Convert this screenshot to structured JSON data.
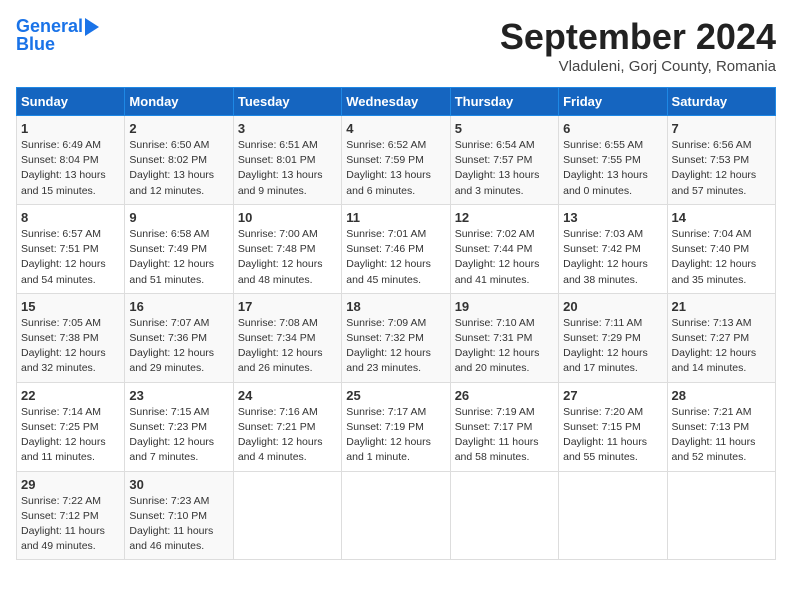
{
  "logo": {
    "line1": "General",
    "line2": "Blue"
  },
  "title": "September 2024",
  "subtitle": "Vladuleni, Gorj County, Romania",
  "headers": [
    "Sunday",
    "Monday",
    "Tuesday",
    "Wednesday",
    "Thursday",
    "Friday",
    "Saturday"
  ],
  "weeks": [
    [
      {
        "day": "1",
        "info": "Sunrise: 6:49 AM\nSunset: 8:04 PM\nDaylight: 13 hours\nand 15 minutes."
      },
      {
        "day": "2",
        "info": "Sunrise: 6:50 AM\nSunset: 8:02 PM\nDaylight: 13 hours\nand 12 minutes."
      },
      {
        "day": "3",
        "info": "Sunrise: 6:51 AM\nSunset: 8:01 PM\nDaylight: 13 hours\nand 9 minutes."
      },
      {
        "day": "4",
        "info": "Sunrise: 6:52 AM\nSunset: 7:59 PM\nDaylight: 13 hours\nand 6 minutes."
      },
      {
        "day": "5",
        "info": "Sunrise: 6:54 AM\nSunset: 7:57 PM\nDaylight: 13 hours\nand 3 minutes."
      },
      {
        "day": "6",
        "info": "Sunrise: 6:55 AM\nSunset: 7:55 PM\nDaylight: 13 hours\nand 0 minutes."
      },
      {
        "day": "7",
        "info": "Sunrise: 6:56 AM\nSunset: 7:53 PM\nDaylight: 12 hours\nand 57 minutes."
      }
    ],
    [
      {
        "day": "8",
        "info": "Sunrise: 6:57 AM\nSunset: 7:51 PM\nDaylight: 12 hours\nand 54 minutes."
      },
      {
        "day": "9",
        "info": "Sunrise: 6:58 AM\nSunset: 7:49 PM\nDaylight: 12 hours\nand 51 minutes."
      },
      {
        "day": "10",
        "info": "Sunrise: 7:00 AM\nSunset: 7:48 PM\nDaylight: 12 hours\nand 48 minutes."
      },
      {
        "day": "11",
        "info": "Sunrise: 7:01 AM\nSunset: 7:46 PM\nDaylight: 12 hours\nand 45 minutes."
      },
      {
        "day": "12",
        "info": "Sunrise: 7:02 AM\nSunset: 7:44 PM\nDaylight: 12 hours\nand 41 minutes."
      },
      {
        "day": "13",
        "info": "Sunrise: 7:03 AM\nSunset: 7:42 PM\nDaylight: 12 hours\nand 38 minutes."
      },
      {
        "day": "14",
        "info": "Sunrise: 7:04 AM\nSunset: 7:40 PM\nDaylight: 12 hours\nand 35 minutes."
      }
    ],
    [
      {
        "day": "15",
        "info": "Sunrise: 7:05 AM\nSunset: 7:38 PM\nDaylight: 12 hours\nand 32 minutes."
      },
      {
        "day": "16",
        "info": "Sunrise: 7:07 AM\nSunset: 7:36 PM\nDaylight: 12 hours\nand 29 minutes."
      },
      {
        "day": "17",
        "info": "Sunrise: 7:08 AM\nSunset: 7:34 PM\nDaylight: 12 hours\nand 26 minutes."
      },
      {
        "day": "18",
        "info": "Sunrise: 7:09 AM\nSunset: 7:32 PM\nDaylight: 12 hours\nand 23 minutes."
      },
      {
        "day": "19",
        "info": "Sunrise: 7:10 AM\nSunset: 7:31 PM\nDaylight: 12 hours\nand 20 minutes."
      },
      {
        "day": "20",
        "info": "Sunrise: 7:11 AM\nSunset: 7:29 PM\nDaylight: 12 hours\nand 17 minutes."
      },
      {
        "day": "21",
        "info": "Sunrise: 7:13 AM\nSunset: 7:27 PM\nDaylight: 12 hours\nand 14 minutes."
      }
    ],
    [
      {
        "day": "22",
        "info": "Sunrise: 7:14 AM\nSunset: 7:25 PM\nDaylight: 12 hours\nand 11 minutes."
      },
      {
        "day": "23",
        "info": "Sunrise: 7:15 AM\nSunset: 7:23 PM\nDaylight: 12 hours\nand 7 minutes."
      },
      {
        "day": "24",
        "info": "Sunrise: 7:16 AM\nSunset: 7:21 PM\nDaylight: 12 hours\nand 4 minutes."
      },
      {
        "day": "25",
        "info": "Sunrise: 7:17 AM\nSunset: 7:19 PM\nDaylight: 12 hours\nand 1 minute."
      },
      {
        "day": "26",
        "info": "Sunrise: 7:19 AM\nSunset: 7:17 PM\nDaylight: 11 hours\nand 58 minutes."
      },
      {
        "day": "27",
        "info": "Sunrise: 7:20 AM\nSunset: 7:15 PM\nDaylight: 11 hours\nand 55 minutes."
      },
      {
        "day": "28",
        "info": "Sunrise: 7:21 AM\nSunset: 7:13 PM\nDaylight: 11 hours\nand 52 minutes."
      }
    ],
    [
      {
        "day": "29",
        "info": "Sunrise: 7:22 AM\nSunset: 7:12 PM\nDaylight: 11 hours\nand 49 minutes."
      },
      {
        "day": "30",
        "info": "Sunrise: 7:23 AM\nSunset: 7:10 PM\nDaylight: 11 hours\nand 46 minutes."
      },
      null,
      null,
      null,
      null,
      null
    ]
  ]
}
